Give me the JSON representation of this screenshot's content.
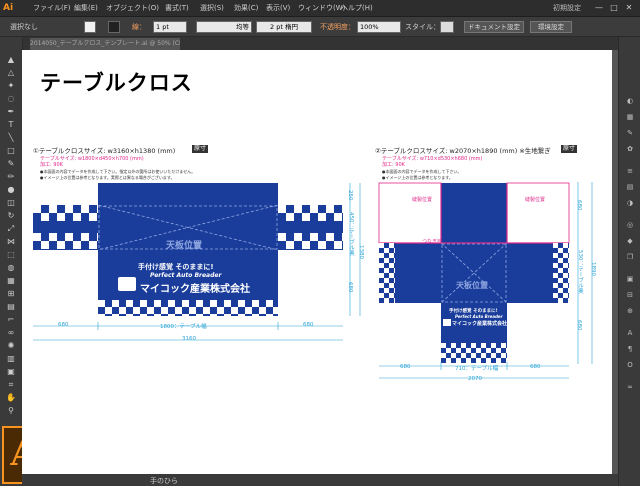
{
  "app": {
    "logo": "Ai",
    "workspace": "初期設定"
  },
  "menu": [
    "ファイル(F)",
    "編集(E)",
    "オブジェクト(O)",
    "書式(T)",
    "選択(S)",
    "効果(C)",
    "表示(V)",
    "ウィンドウ(W)",
    "ヘルプ(H)"
  ],
  "window_buttons": [
    "—",
    "□",
    "✕"
  ],
  "control_bar": {
    "selection": "選択なし",
    "stroke_label": "線：",
    "stroke_value": "1 pt",
    "line_style": "均等",
    "brush": "2 pt 楕円",
    "opacity_label": "不透明度：",
    "opacity_value": "100%",
    "style_label": "スタイル：",
    "doc_settings": "ドキュメント設定",
    "prefs": "環境設定"
  },
  "doc_tab": "2014050_テーブルクロス_テンプレート.ai @ 50% (CMYK/プレビュー)",
  "status_tool": "手のひら",
  "artboard": {
    "title": "テーブルクロス",
    "left": {
      "caption": "①テーブルクロスサイズ: w3160×h1380 (mm)",
      "tag": "原寸",
      "red1": "テーブルサイズ: w1800×d450×h700 (mm)",
      "red2": "加工: 90K",
      "note1": "●本図面の内容でデータを作成して下さい。指定以外の箇所はお使いいただけません。",
      "note2": "●イメージ上の位置は参考となります。実際とは異なる場合がございます。",
      "center_label": "天板位置",
      "line1": "手付け感覚 そのままに!",
      "line2": "Perfect Auto Breader",
      "company": "マイコック産業株式会社",
      "dims": {
        "w_side": "680",
        "w_mid": "1800：テーブル幅",
        "w_side2": "680",
        "total": "3160",
        "h_top": "250",
        "h_mid": "450：テーブル奥",
        "h_bottom": "680",
        "h_total": "1380"
      }
    },
    "right": {
      "caption": "②テーブルクロスサイズ: w2070×h1890 (mm) ※生地繋ぎ",
      "tag": "原寸",
      "red1": "テーブルサイズ: w710×d530×h680 (mm)",
      "red2": "加工: 90K",
      "note1": "●本図面の内容でデータを作成して下さい。",
      "note2": "●イメージ上の位置は参考となります。",
      "seam1": "縫製位置",
      "seam2": "縫製位置",
      "seam3": "つなぎ目",
      "center_label": "天板位置",
      "line1": "手付け感覚 そのままに!",
      "line2": "Perfect Auto Breader",
      "company": "マイコック産業株式会社",
      "dims": {
        "w_side": "680",
        "w_mid": "710：テーブル幅",
        "w_side2": "680",
        "total": "2070",
        "h_top": "680",
        "h_mid": "530：テーブル奥",
        "h_bottom": "680",
        "h_total": "1890"
      }
    }
  },
  "colors": {
    "brand_blue": "#1a3d9b",
    "dim_cyan": "#29a3d6",
    "accent_red": "#e0288a",
    "ai_orange": "#f7931e"
  }
}
